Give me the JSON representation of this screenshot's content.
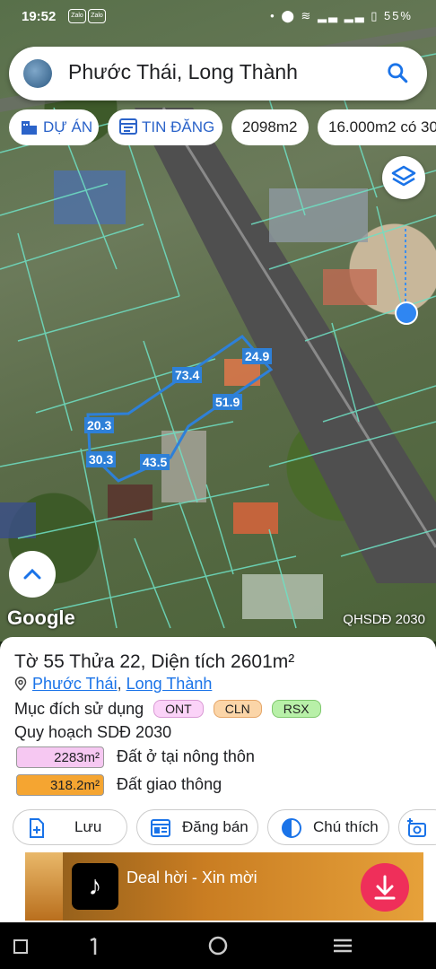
{
  "status_bar": {
    "time": "19:52",
    "icons": [
      "zalo-icon",
      "zalo-icon"
    ],
    "battery": "55%"
  },
  "search": {
    "query": "Phước Thái, Long Thành"
  },
  "chips": [
    {
      "label": "DỰ ÁN",
      "icon": "building-icon"
    },
    {
      "label": "TIN ĐĂNG",
      "icon": "listing-icon"
    },
    {
      "label": "2098m2"
    },
    {
      "label": "16.000m2 có 30"
    }
  ],
  "map": {
    "watermark": "Google",
    "layer_label": "QHSDĐ 2030",
    "segments": [
      "73.4",
      "24.9",
      "51.9",
      "20.3",
      "30.3",
      "43.5"
    ]
  },
  "parcel": {
    "title": "Tờ 55 Thửa 22, Diện tích 2601m²",
    "ward": "Phước Thái",
    "separator": ",",
    "district": "Long Thành",
    "purpose_label": "Mục đích sử dụng",
    "purpose_tags": [
      "ONT",
      "CLN",
      "RSX"
    ],
    "plan_label": "Quy hoạch SDĐ 2030",
    "plan_rows": [
      {
        "amount": "2283m²",
        "label": "Đất ở tại nông thôn",
        "color": "#f6c8f2"
      },
      {
        "amount": "318.2m²",
        "label": "Đất giao thông",
        "color": "#f5a531"
      }
    ]
  },
  "actions": {
    "save": "Lưu",
    "post": "Đăng bán",
    "legend": "Chú thích"
  },
  "ad": {
    "text": "Deal hời - Xin mời"
  },
  "colors": {
    "accent": "#2b63c9",
    "parcel_line": "#2e80d8",
    "plot_lines": "#6fe0c4",
    "download": "#ef2f5a"
  }
}
